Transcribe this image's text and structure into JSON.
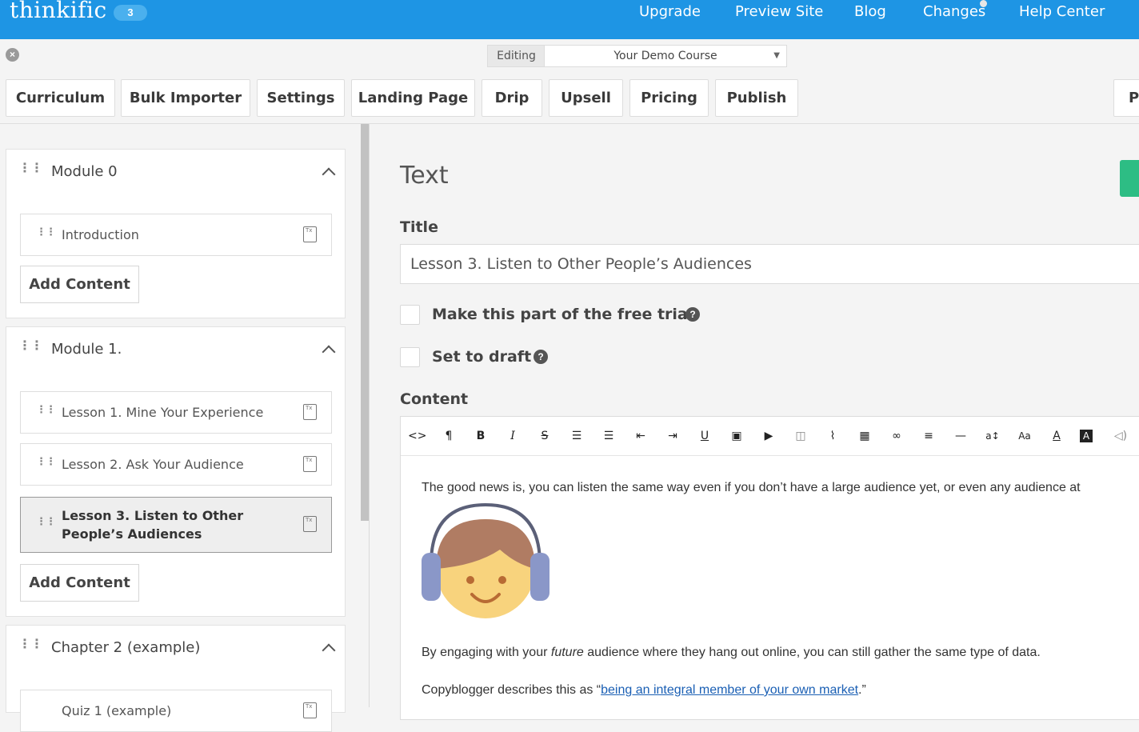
{
  "nav": {
    "logo": "thinkific",
    "badge": "3",
    "links": [
      "Upgrade",
      "Preview Site",
      "Blog",
      "Changes",
      "Help Center"
    ]
  },
  "editing": {
    "label": "Editing",
    "course": "Your Demo Course"
  },
  "tabs": [
    "Curriculum",
    "Bulk Importer",
    "Settings",
    "Landing Page",
    "Drip",
    "Upsell",
    "Pricing",
    "Publish",
    "Pr"
  ],
  "sidebar": {
    "modules": [
      {
        "title": "Module 0",
        "lessons": [
          "Introduction"
        ],
        "add_label": "Add Content"
      },
      {
        "title": "Module 1.",
        "lessons": [
          "Lesson 1. Mine Your Experience",
          "Lesson 2. Ask Your Audience",
          "Lesson 3. Listen to Other People’s Audiences"
        ],
        "add_label": "Add Content"
      },
      {
        "title": "Chapter 2 (example)",
        "lessons": [
          "Quiz 1 (example)"
        ]
      }
    ]
  },
  "main": {
    "heading": "Text",
    "title_label": "Title",
    "title_value": "Lesson 3. Listen to Other People’s Audiences",
    "free_trial_label": "Make this part of the free trial",
    "draft_label": "Set to draft",
    "content_label": "Content",
    "paragraph1": "The good news is, you can listen the same way even if you don’t have a large audience yet, or even any audience at",
    "paragraph2_a": "By engaging with your ",
    "paragraph2_em": "future",
    "paragraph2_b": " audience where they hang out online, you can still gather the same type of data.",
    "paragraph3_a": "Copyblogger describes this as “",
    "paragraph3_link": "being an integral member of your own market",
    "paragraph3_b": ".”"
  }
}
